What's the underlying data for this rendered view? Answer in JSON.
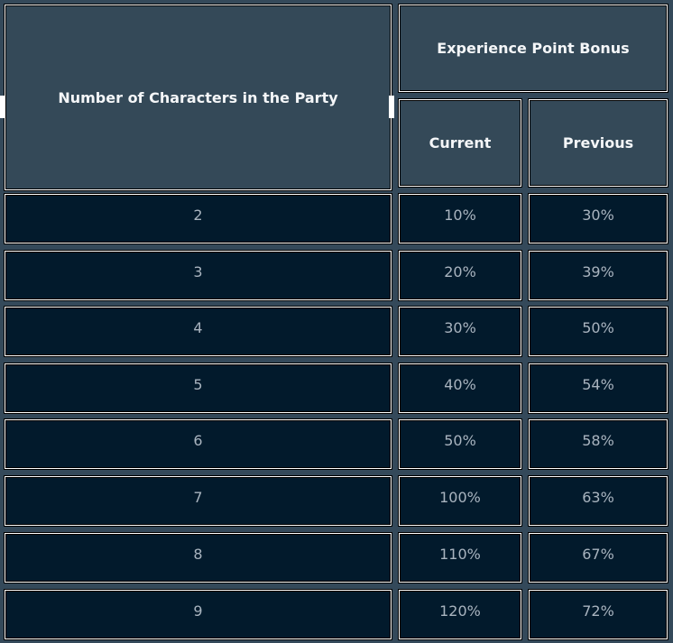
{
  "table": {
    "header": {
      "party_size": "Number of Characters in the Party",
      "xp_bonus": "Experience Point Bonus",
      "current": "Current",
      "previous": "Previous"
    },
    "rows": [
      {
        "party_size": "2",
        "current": "10%",
        "previous": "30%"
      },
      {
        "party_size": "3",
        "current": "20%",
        "previous": "39%"
      },
      {
        "party_size": "4",
        "current": "30%",
        "previous": "50%"
      },
      {
        "party_size": "5",
        "current": "40%",
        "previous": "54%"
      },
      {
        "party_size": "6",
        "current": "50%",
        "previous": "58%"
      },
      {
        "party_size": "7",
        "current": "100%",
        "previous": "63%"
      },
      {
        "party_size": "8",
        "current": "110%",
        "previous": "67%"
      },
      {
        "party_size": "9",
        "current": "120%",
        "previous": "72%"
      }
    ]
  },
  "colors": {
    "background": "#34495a",
    "header_cell": "#344958",
    "body_cell": "#021a2c",
    "header_text": "#f4f6f8",
    "body_text": "#a9b4bf"
  }
}
